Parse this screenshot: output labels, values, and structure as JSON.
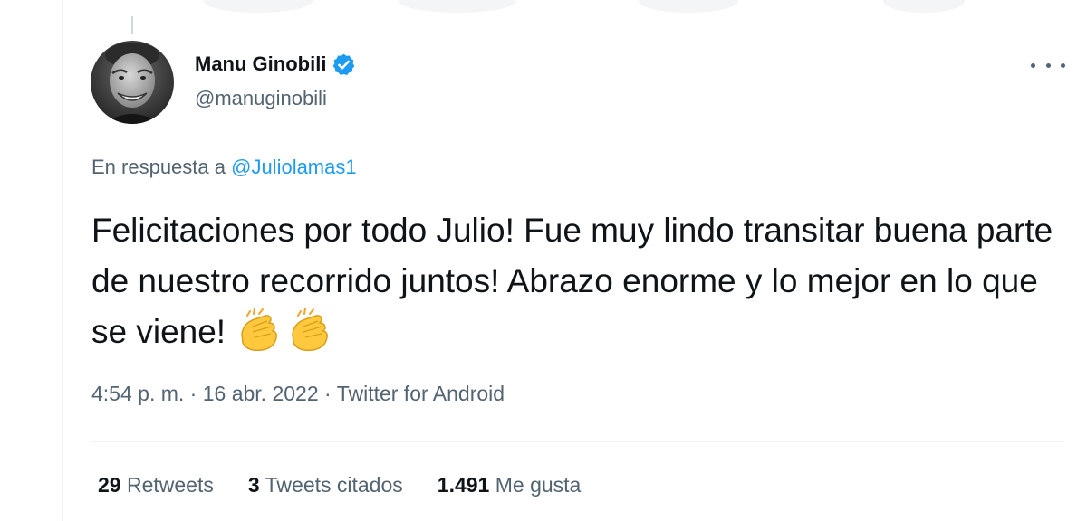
{
  "tweet": {
    "author": {
      "display_name": "Manu Ginobili",
      "handle": "@manuginobili",
      "verified": true
    },
    "reply_to": {
      "prefix": "En respuesta a",
      "mention": "@Juliolamas1"
    },
    "text": "Felicitaciones por todo Julio! Fue muy lindo transitar buena parte de nuestro recorrido juntos! Abrazo enorme y lo mejor en lo que se viene!",
    "emojis": [
      "clapping-hands",
      "clapping-hands"
    ],
    "meta": {
      "time": "4:54 p. m.",
      "separator": "·",
      "date": "16 abr. 2022",
      "source": "Twitter for Android"
    },
    "stats": [
      {
        "count": "29",
        "label": "Retweets"
      },
      {
        "count": "3",
        "label": "Tweets citados"
      },
      {
        "count": "1.491",
        "label": "Me gusta"
      }
    ]
  },
  "colors": {
    "primary_text": "#0f1419",
    "secondary_text": "#536471",
    "link": "#1d9bf0",
    "verified_badge": "#1d9bf0",
    "divider": "#eff3f4",
    "emoji_yellow": "#ffc83d"
  }
}
